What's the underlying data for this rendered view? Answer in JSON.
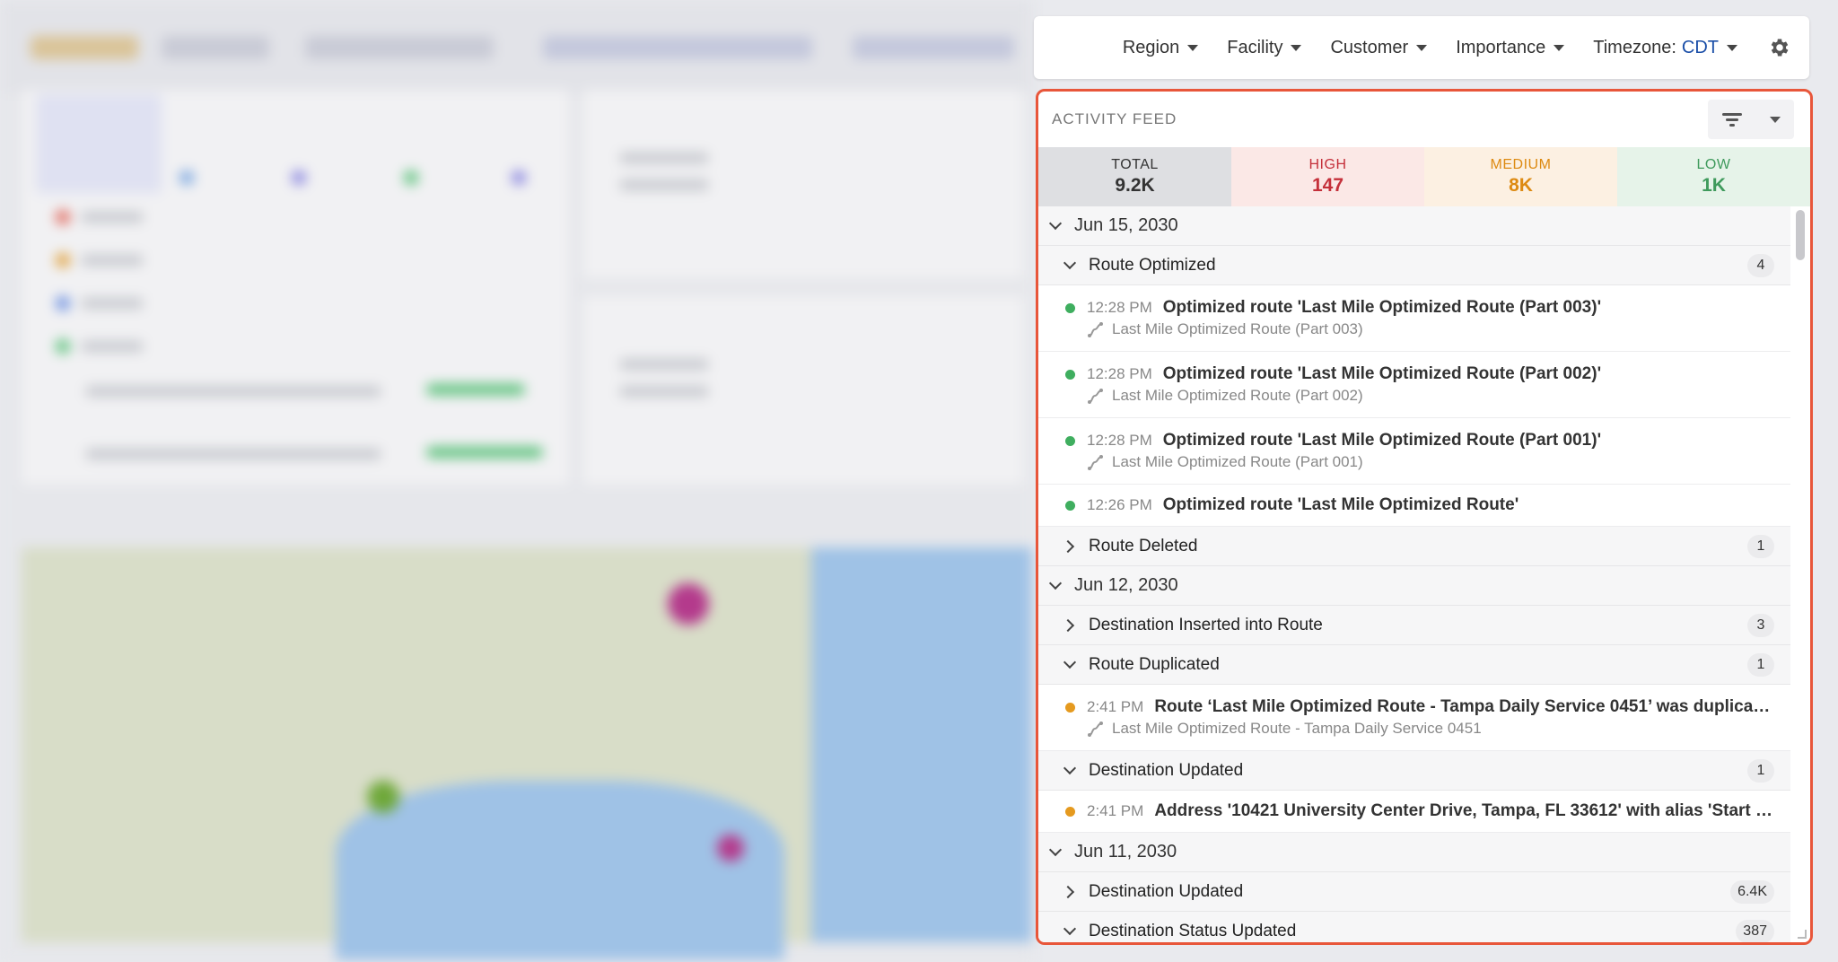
{
  "filters": {
    "region": "Region",
    "facility": "Facility",
    "customer": "Customer",
    "importance": "Importance",
    "timezone_label": "Timezone:",
    "timezone_value": "CDT",
    "settings_icon": "gear-icon"
  },
  "feed": {
    "title": "ACTIVITY FEED",
    "filter_icon": "filter-icon",
    "stats": {
      "total": {
        "label": "TOTAL",
        "value": "9.2K"
      },
      "high": {
        "label": "HIGH",
        "value": "147"
      },
      "medium": {
        "label": "MEDIUM",
        "value": "8K"
      },
      "low": {
        "label": "LOW",
        "value": "1K"
      }
    },
    "colors": {
      "accent_border": "#e8563a",
      "low_dot": "#3fae5f",
      "medium_dot": "#e59a1f"
    },
    "days": [
      {
        "date": "Jun 15, 2030",
        "groups": [
          {
            "name": "Route Optimized",
            "count": "4",
            "expanded": true,
            "events": [
              {
                "time": "12:28 PM",
                "message": "Optimized route 'Last Mile Optimized Route (Part 003)'",
                "sub": "Last Mile Optimized Route (Part 003)"
              },
              {
                "time": "12:28 PM",
                "message": "Optimized route 'Last Mile Optimized Route (Part 002)'",
                "sub": "Last Mile Optimized Route (Part 002)"
              },
              {
                "time": "12:28 PM",
                "message": "Optimized route 'Last Mile Optimized Route (Part 001)'",
                "sub": "Last Mile Optimized Route (Part 001)"
              },
              {
                "time": "12:26 PM",
                "message": "Optimized route 'Last Mile Optimized Route'"
              }
            ]
          },
          {
            "name": "Route Deleted",
            "count": "1",
            "expanded": false
          }
        ]
      },
      {
        "date": "Jun 12, 2030",
        "groups": [
          {
            "name": "Destination Inserted into Route",
            "count": "3",
            "expanded": false
          },
          {
            "name": "Route Duplicated",
            "count": "1",
            "expanded": true,
            "events": [
              {
                "time": "2:41 PM",
                "message": "Route ‘Last Mile Optimized Route - Tampa Daily Service 0451’ was duplicated...",
                "sub": "Last Mile Optimized Route - Tampa Daily Service 0451"
              }
            ]
          },
          {
            "name": "Destination Updated",
            "count": "1",
            "expanded": true,
            "events": [
              {
                "time": "2:41 PM",
                "message": "Address '10421 University Center Drive, Tampa, FL 33612' with alias 'Start L..."
              }
            ]
          }
        ]
      },
      {
        "date": "Jun 11, 2030",
        "groups": [
          {
            "name": "Destination Updated",
            "count": "6.4K",
            "expanded": false
          },
          {
            "name": "Destination Status Updated",
            "count": "387",
            "expanded": true
          }
        ]
      }
    ]
  }
}
